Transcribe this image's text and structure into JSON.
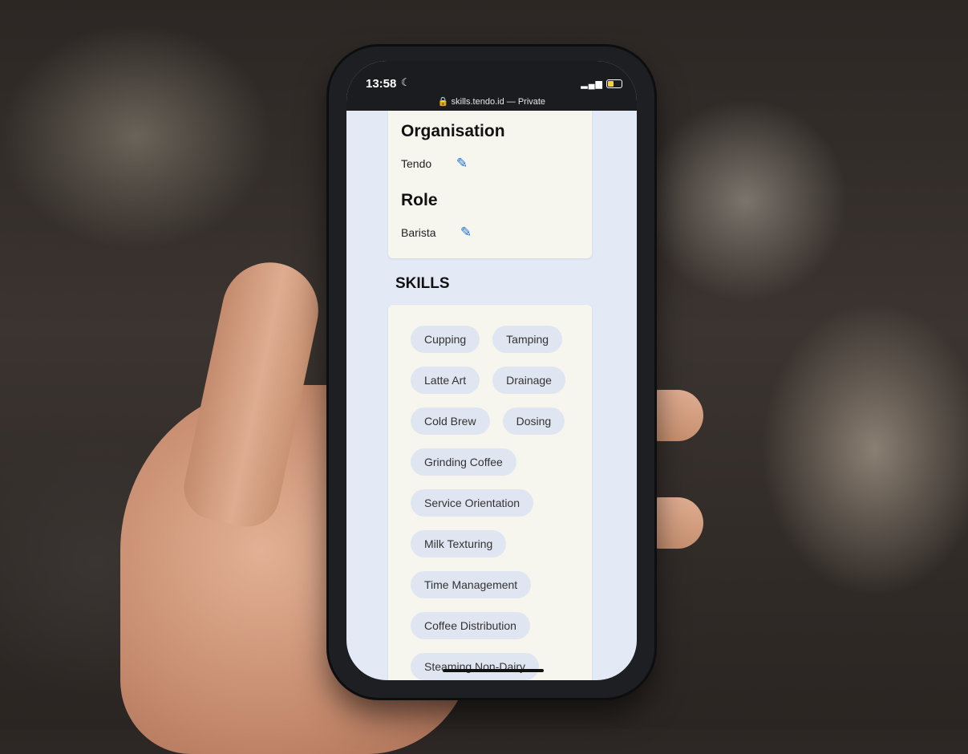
{
  "status_bar": {
    "time": "13:58",
    "moon": "☾",
    "signal": "▂▄▆",
    "url": "🔒 skills.tendo.id — Private"
  },
  "profile": {
    "organisation_heading": "Organisation",
    "organisation_value": "Tendo",
    "role_heading": "Role",
    "role_value": "Barista"
  },
  "skills": {
    "heading": "SKILLS",
    "rows": [
      [
        "Cupping",
        "Tamping"
      ],
      [
        "Latte Art",
        "Drainage"
      ],
      [
        "Cold Brew",
        "Dosing"
      ],
      [
        "Grinding Coffee"
      ],
      [
        "Service Orientation"
      ],
      [
        "Milk Texturing"
      ],
      [
        "Time Management"
      ],
      [
        "Coffee Distribution"
      ],
      [
        "Steaming Non-Dairy"
      ]
    ]
  },
  "icons": {
    "edit": "✎"
  },
  "colors": {
    "accent": "#1a6fd6",
    "chip_bg": "#dfe6f1",
    "card_bg": "#f6f6ef"
  }
}
